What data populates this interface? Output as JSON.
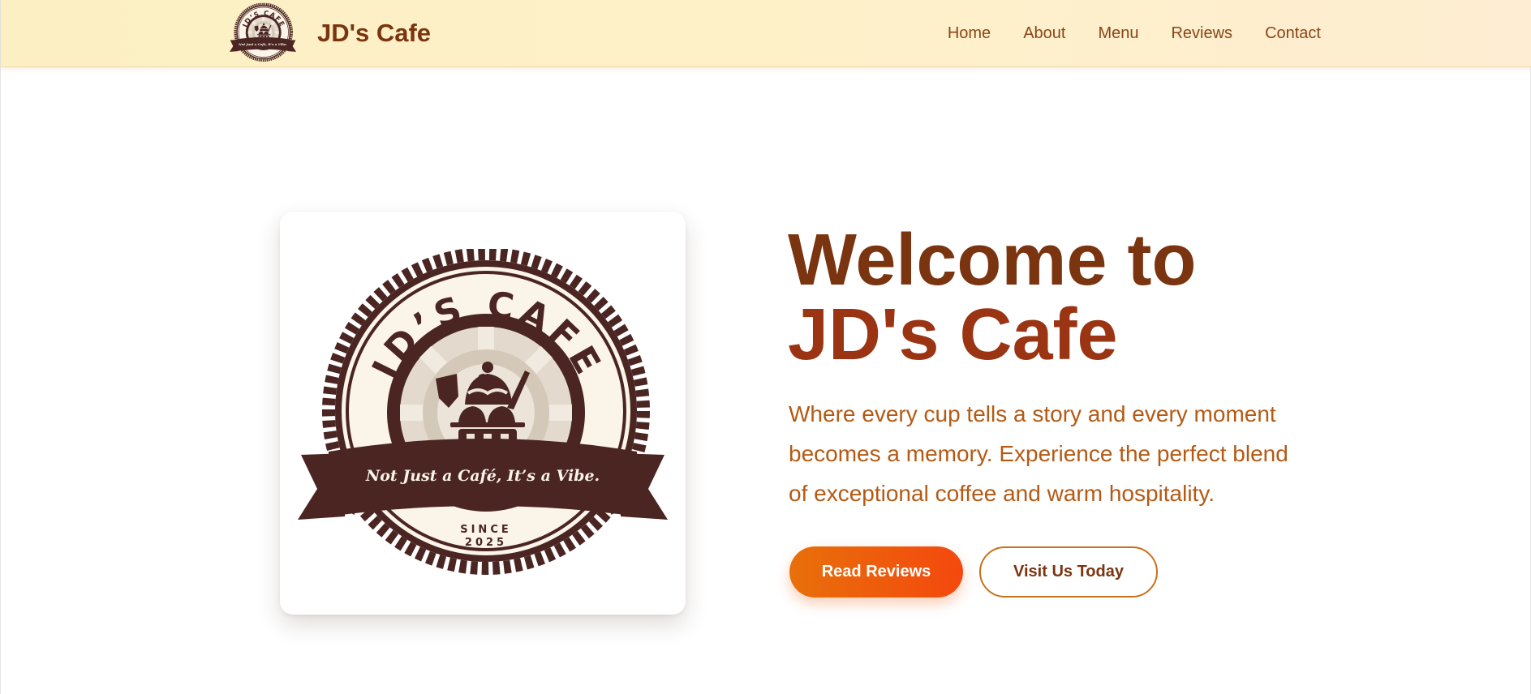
{
  "header": {
    "brand_name": "JD's Cafe",
    "nav": [
      "Home",
      "About",
      "Menu",
      "Reviews",
      "Contact"
    ]
  },
  "logo": {
    "arc_text": "JD’S CAFE",
    "banner_text": "Not Just a Café, It’s a Vibe.",
    "since_label": "SINCE",
    "since_year": "2025"
  },
  "hero": {
    "title_line1": "Welcome to",
    "title_line2": "JD's Cafe",
    "subtitle": "Where every cup tells a story and every moment becomes a memory. Experience the perfect blend of exceptional coffee and warm hospitality.",
    "primary_button": "Read Reviews",
    "secondary_button": "Visit Us Today"
  },
  "colors": {
    "brand_brown": "#7a3410",
    "logo_dark": "#4a2522",
    "accent_orange": "#f4480e",
    "header_cream": "#fef1c8"
  }
}
